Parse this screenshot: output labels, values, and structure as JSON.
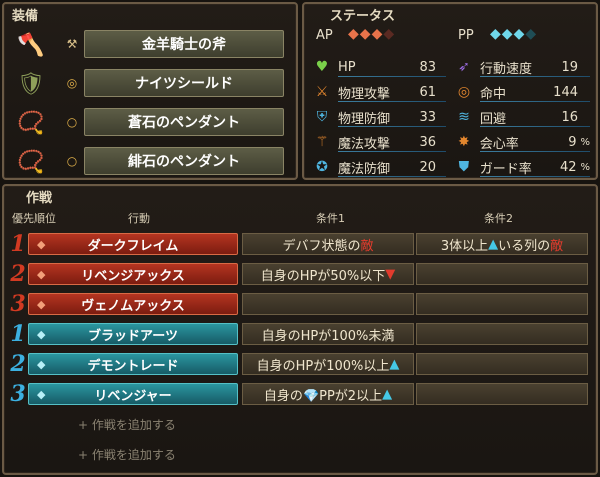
{
  "equipment": {
    "title": "装備",
    "items": [
      {
        "name": "金羊騎士の斧",
        "icon": "axe-icon",
        "type_icon": "axe-type-icon"
      },
      {
        "name": "ナイツシールド",
        "icon": "shield-icon",
        "type_icon": "shield-type-icon"
      },
      {
        "name": "蒼石のペンダント",
        "icon": "pendant-icon",
        "type_icon": "ring-type-icon"
      },
      {
        "name": "緋石のペンダント",
        "icon": "pendant-icon",
        "type_icon": "ring-type-icon"
      }
    ]
  },
  "status": {
    "title": "ステータス",
    "ap_label": "AP",
    "pp_label": "PP",
    "ap_filled": 3,
    "ap_total": 4,
    "pp_filled": 3,
    "pp_total": 4,
    "left": [
      {
        "label": "HP",
        "value": "83",
        "icon": "heart-icon",
        "color": "#7ad04a"
      },
      {
        "label": "物理攻撃",
        "value": "61",
        "icon": "sword-icon",
        "color": "#e2862e"
      },
      {
        "label": "物理防御",
        "value": "33",
        "icon": "armor-icon",
        "color": "#4fb5e0"
      },
      {
        "label": "魔法攻撃",
        "value": "36",
        "icon": "staff-icon",
        "color": "#e2862e"
      },
      {
        "label": "魔法防御",
        "value": "20",
        "icon": "magic-shield-icon",
        "color": "#4fb5e0"
      }
    ],
    "right": [
      {
        "label": "行動速度",
        "value": "19",
        "unit": "",
        "icon": "speed-icon",
        "color": "#9a6be0"
      },
      {
        "label": "命中",
        "value": "144",
        "unit": "",
        "icon": "target-icon",
        "color": "#e2862e"
      },
      {
        "label": "回避",
        "value": "16",
        "unit": "",
        "icon": "evade-icon",
        "color": "#4fb5e0"
      },
      {
        "label": "会心率",
        "value": "9",
        "unit": "%",
        "icon": "critical-icon",
        "color": "#e2862e"
      },
      {
        "label": "ガード率",
        "value": "42",
        "unit": "%",
        "icon": "guard-icon",
        "color": "#4fb5e0"
      }
    ]
  },
  "tactics": {
    "title": "作戦",
    "headers": {
      "priority": "優先順位",
      "action": "行動",
      "cond1": "条件1",
      "cond2": "条件2"
    },
    "rows": [
      {
        "prio": "1",
        "kind": "red",
        "action": "ダークフレイム",
        "gem": "ap-gem-icon",
        "c1_a": "デバフ状態の",
        "c1_hl": "敵",
        "c1_b": "",
        "c1_mark": "",
        "c2_a": "3体以上",
        "c2_mark": "▲",
        "c2_b": "いる列の",
        "c2_hl": "敵"
      },
      {
        "prio": "2",
        "kind": "red",
        "action": "リベンジアックス",
        "gem": "ap-gem-icon",
        "c1_a": "自身のHPが",
        "c1_hl": "",
        "c1_b": "50%以下",
        "c1_mark": "▼",
        "c2_a": "",
        "c2_mark": "",
        "c2_b": "",
        "c2_hl": ""
      },
      {
        "prio": "3",
        "kind": "red",
        "action": "ヴェノムアックス",
        "gem": "ap-gem-icon",
        "c1_a": "",
        "c1_hl": "",
        "c1_b": "",
        "c1_mark": "",
        "c2_a": "",
        "c2_mark": "",
        "c2_b": "",
        "c2_hl": ""
      },
      {
        "prio": "1",
        "kind": "blue",
        "action": "ブラッドアーツ",
        "gem": "pp-gem-icon",
        "c1_a": "自身のHPが",
        "c1_hl": "",
        "c1_b": "100%未満",
        "c1_mark": "",
        "c2_a": "",
        "c2_mark": "",
        "c2_b": "",
        "c2_hl": ""
      },
      {
        "prio": "2",
        "kind": "blue",
        "action": "デモントレード",
        "gem": "pp-gem-icon",
        "c1_a": "自身のHPが",
        "c1_hl": "",
        "c1_b": "100%以上",
        "c1_mark": "▲",
        "c2_a": "",
        "c2_mark": "",
        "c2_b": "",
        "c2_hl": ""
      },
      {
        "prio": "3",
        "kind": "blue",
        "action": "リベンジャー",
        "gem": "pp-gem-icon",
        "c1_a": "自身の",
        "c1_hl": "",
        "c1_b": "💎PPが2以上",
        "c1_mark": "▲",
        "c2_a": "",
        "c2_mark": "",
        "c2_b": "",
        "c2_hl": ""
      }
    ],
    "add_label": "+ 作戦を追加する",
    "add_label_2": "+ 作戦を追加する"
  },
  "colors": {
    "red_action": "#b53521",
    "blue_action": "#2b96a0",
    "prio_red": "#d23a22",
    "prio_blue": "#3cb0e0",
    "highlight": "#e23b2d",
    "up_arrow": "#45c8e6"
  }
}
